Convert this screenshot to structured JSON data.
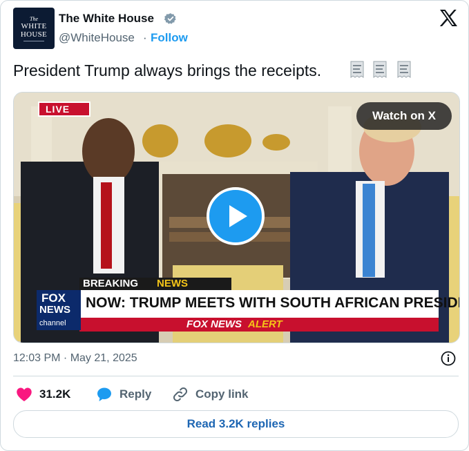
{
  "author": {
    "name": "The White House",
    "handle": "@WhiteHouse",
    "separator": "·",
    "follow_label": "Follow",
    "avatar": {
      "the": "The",
      "line1": "WHITE",
      "line2": "HOUSE"
    },
    "verified_badge_color": "#829aab"
  },
  "tweet": {
    "text": "President Trump always brings the receipts.",
    "emoji_icons": [
      "receipt-icon",
      "receipt-icon",
      "receipt-icon"
    ],
    "timestamp": "12:03 PM · May 21, 2025"
  },
  "media": {
    "watch_label": "Watch on X",
    "live_label": "LIVE",
    "breaking_label": "BREAKING",
    "news_label": "NEWS",
    "headline": "NOW: TRUMP MEETS WITH SOUTH AFRICAN PRESIDENT",
    "alert_brand": "FOX NEWS",
    "alert_word": "ALERT",
    "logo_line1": "FOX",
    "logo_line2": "NEWS",
    "logo_line3": "channel"
  },
  "actions": {
    "likes": "31.2K",
    "reply": "Reply",
    "copy": "Copy link",
    "read_replies": "Read 3.2K replies"
  },
  "colors": {
    "accent": "#1d9bf0",
    "like": "#f91880",
    "text": "#0f1419",
    "muted": "#536471",
    "border": "#cfd9de"
  }
}
